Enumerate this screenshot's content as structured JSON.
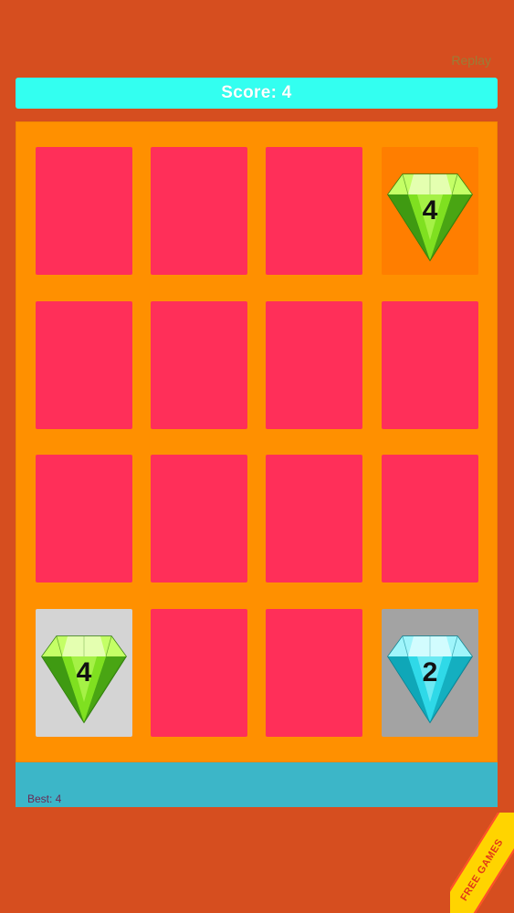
{
  "header": {
    "replay_label": "Replay",
    "score_text": "Score: 4"
  },
  "footer": {
    "best_text": "Best: 4"
  },
  "badge": {
    "text": "FREE GAMES"
  },
  "colors": {
    "background": "#d64e1f",
    "score_bar": "#33fff0",
    "board": "#ff9000",
    "tile_hidden": "#ff2f59",
    "best_bar": "#3cb6c8"
  },
  "tiles": [
    {
      "state": "hidden"
    },
    {
      "state": "hidden"
    },
    {
      "state": "hidden"
    },
    {
      "state": "revealed",
      "gem": "green-gem",
      "value": "4",
      "face": "orange"
    },
    {
      "state": "hidden"
    },
    {
      "state": "hidden"
    },
    {
      "state": "hidden"
    },
    {
      "state": "hidden"
    },
    {
      "state": "hidden"
    },
    {
      "state": "hidden"
    },
    {
      "state": "hidden"
    },
    {
      "state": "hidden"
    },
    {
      "state": "revealed",
      "gem": "green-gem",
      "value": "4",
      "face": "lightgrey"
    },
    {
      "state": "hidden"
    },
    {
      "state": "hidden"
    },
    {
      "state": "revealed",
      "gem": "cyan-gem",
      "value": "2",
      "face": "grey"
    }
  ]
}
